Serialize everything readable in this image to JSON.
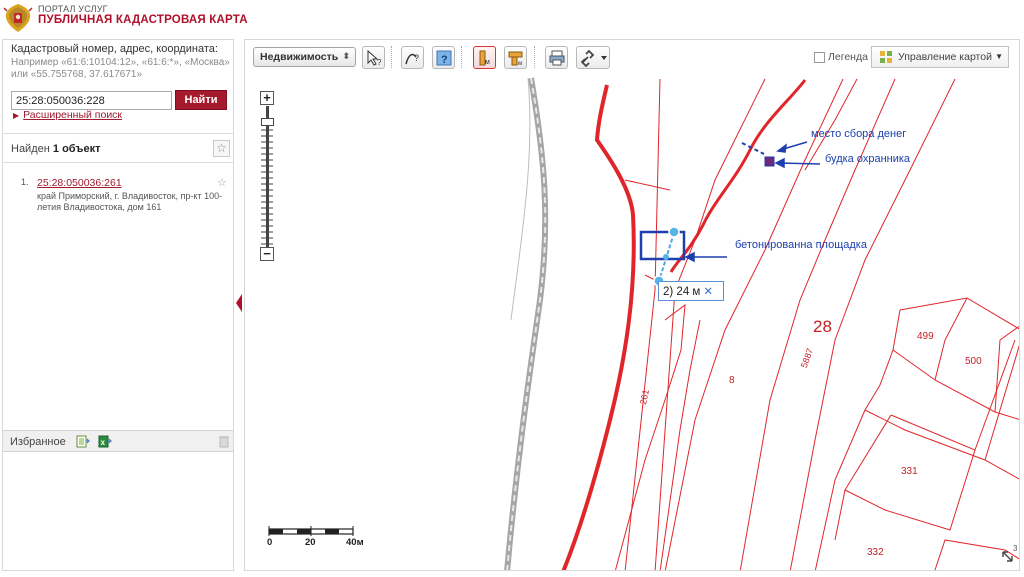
{
  "header": {
    "portal": "ПОРТАЛ УСЛУГ",
    "title": "ПУБЛИЧНАЯ КАДАСТРОВАЯ КАРТА"
  },
  "search": {
    "label": "Кадастровый номер, адрес, координата:",
    "hint": "Например «61:6:10104:12», «61:6:*», «Москва» или «55.755768, 37.617671»",
    "value": "25:28:050036:228",
    "button": "Найти",
    "advanced": "Расширенный поиск"
  },
  "results": {
    "found_prefix": "Найден",
    "found_count": "1 объект",
    "items": [
      {
        "num": "1.",
        "id": "25:28:050036:261",
        "address": "край Приморский, г. Владивосток, пр-кт 100-летия Владивостока, дом 161"
      }
    ]
  },
  "favorites": {
    "label": "Избранное"
  },
  "toolbar": {
    "layer_select": "Недвижимость",
    "legend": "Легенда",
    "map_management": "Управление картой"
  },
  "map": {
    "measurement": "2) 24 м",
    "annotations": {
      "money": "место сбора денег",
      "booth": "будка охранника",
      "pad": "бетонированна площадка"
    },
    "parcel_labels": {
      "p28": "28",
      "p499": "499",
      "p500": "500",
      "p331": "331",
      "p332": "332",
      "p8": "8",
      "p261": "261",
      "p5887": "5887",
      "p3": "3"
    },
    "scale": {
      "s0": "0",
      "s20": "20",
      "s40": "40м"
    }
  },
  "colors": {
    "brand_red": "#a61a2e",
    "parcel_red": "#e0262b",
    "annotation_blue": "#1b3fae",
    "measure_blue": "#5b8fd6"
  }
}
